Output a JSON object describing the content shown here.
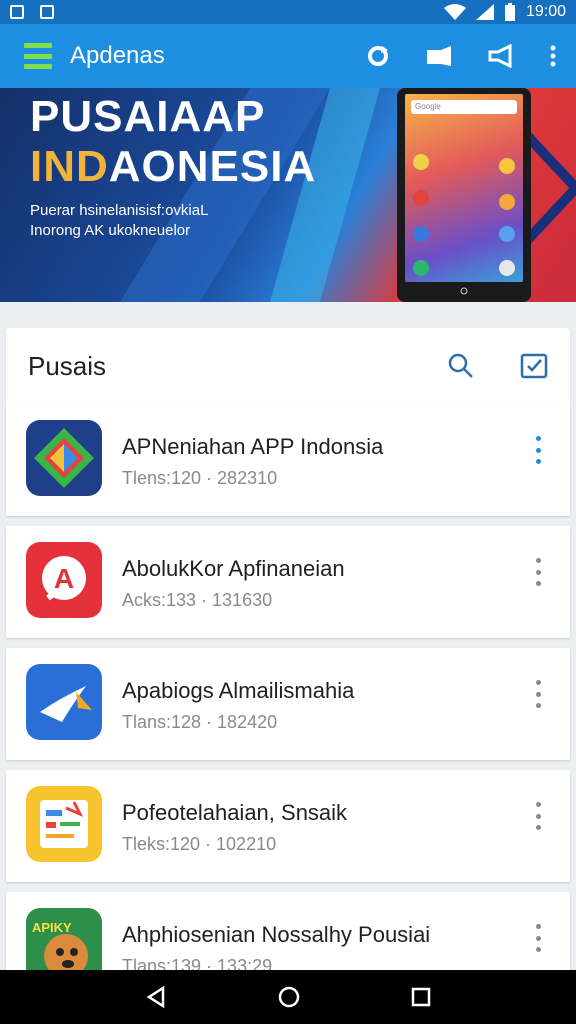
{
  "status": {
    "time": "19:00"
  },
  "app_bar": {
    "title": "Apdenas"
  },
  "banner": {
    "title_line1": "PUSAIAAP",
    "title_line2": "INDAONESIA",
    "subtitle_line1": "Puerar hsinelanisisf:ovkiaL",
    "subtitle_line2": "Inorong AK ukokneuelor",
    "phone_search": "Google"
  },
  "list": {
    "title": "Pusais",
    "items": [
      {
        "name": "APNeniahan APP Indonsia",
        "meta": "Tlens:120 · 282310",
        "icon": "green-diamond-icon"
      },
      {
        "name": "AbolukKor Apfinaneian",
        "meta": "Acks:133 · 131630",
        "icon": "red-a-badge-icon"
      },
      {
        "name": "Apabiogs Almailismahia",
        "meta": "Tlans:128 · 182420",
        "icon": "blue-plane-icon"
      },
      {
        "name": "Pofeotelahaian, Snsaik",
        "meta": "Tleks:120 · 102210",
        "icon": "yellow-chart-icon"
      },
      {
        "name": "Ahphiosenian Nossalhy Pousiai",
        "meta": "Tlans:139 · 133:29",
        "icon": "dog-icon"
      }
    ]
  },
  "colors": {
    "app_bar": "#1e8fe0",
    "status_bar": "#1570c0",
    "accent_green": "#7ee04a"
  }
}
